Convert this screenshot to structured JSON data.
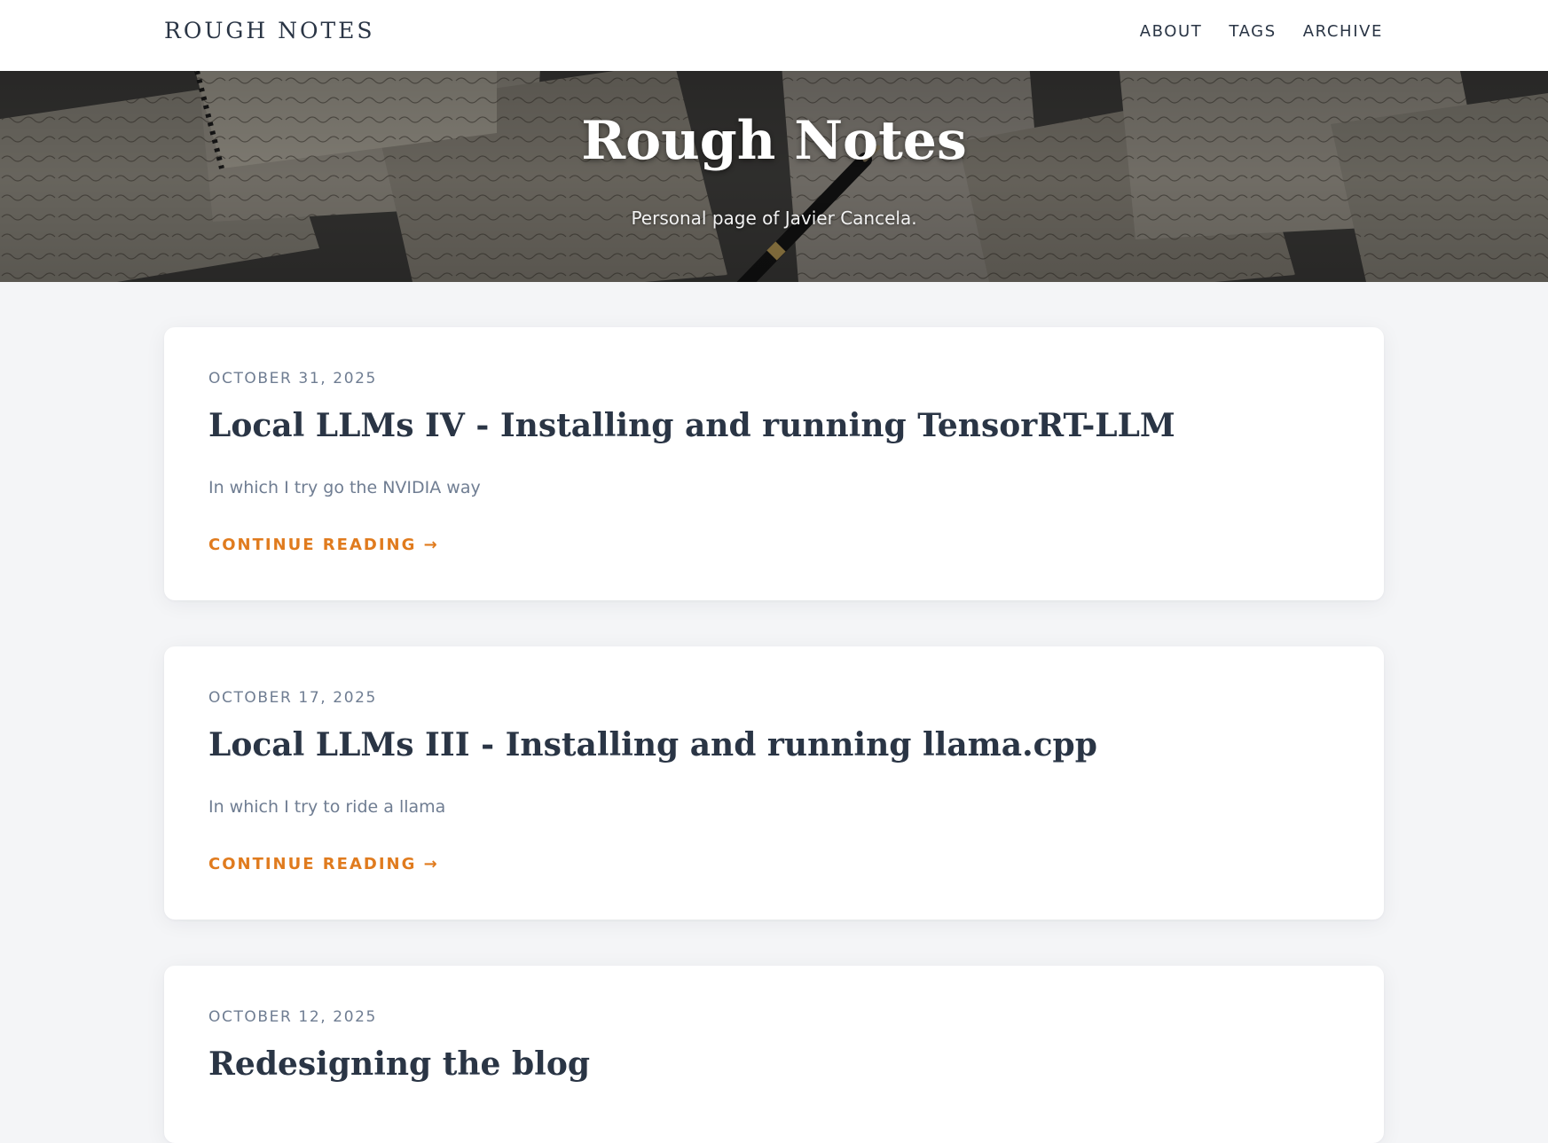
{
  "navbar": {
    "brand": "ROUGH NOTES",
    "links": [
      {
        "label": "ABOUT"
      },
      {
        "label": "TAGS"
      },
      {
        "label": "ARCHIVE"
      }
    ]
  },
  "hero": {
    "title": "Rough Notes",
    "subtitle": "Personal page of Javier Cancela."
  },
  "posts": [
    {
      "date": "OCTOBER 31, 2025",
      "title": "Local LLMs IV - Installing and running TensorRT-LLM",
      "excerpt": "In which I try go the NVIDIA way",
      "more": "CONTINUE READING →"
    },
    {
      "date": "OCTOBER 17, 2025",
      "title": "Local LLMs III - Installing and running llama.cpp",
      "excerpt": "In which I try to ride a llama",
      "more": "CONTINUE READING →"
    },
    {
      "date": "OCTOBER 12, 2025",
      "title": "Redesigning the blog"
    }
  ],
  "colors": {
    "text": "#2a3545",
    "muted": "#6f7d92",
    "accent": "#e07b1e",
    "page_background": "#f4f5f7",
    "card_background": "#ffffff"
  }
}
